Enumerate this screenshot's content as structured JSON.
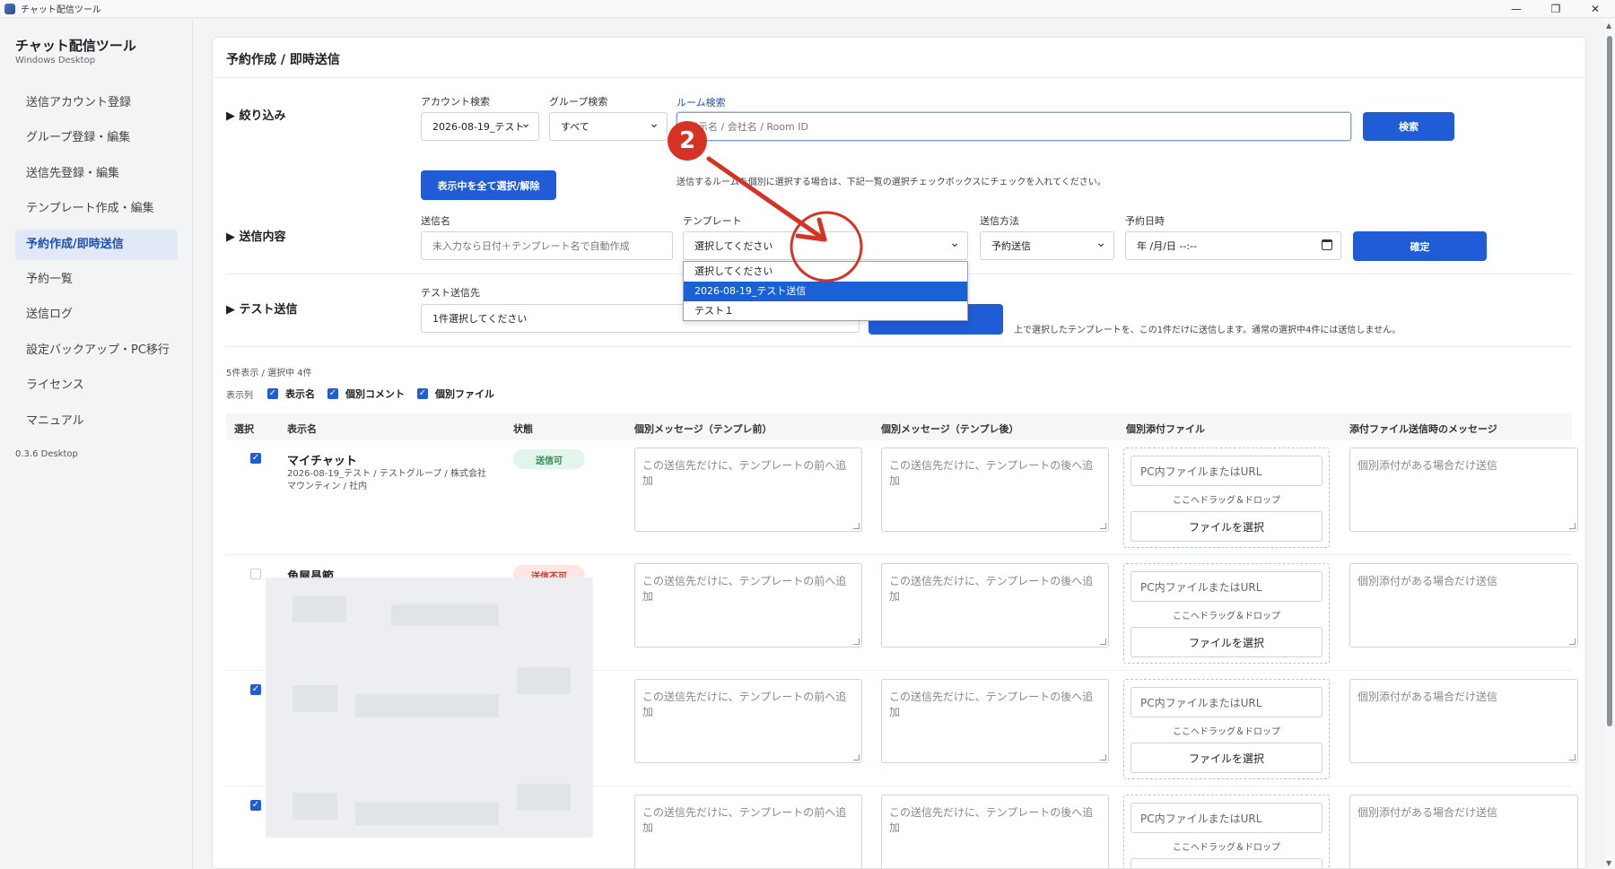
{
  "window": {
    "title": "チャット配信ツール",
    "controls": [
      "—",
      "❐",
      "✕"
    ]
  },
  "sidebar": {
    "brand": "チャット配信ツール",
    "brand_sub": "Windows Desktop",
    "items": [
      {
        "label": "送信アカウント登録"
      },
      {
        "label": "グループ登録・編集"
      },
      {
        "label": "送信先登録・編集"
      },
      {
        "label": "テンプレート作成・編集"
      },
      {
        "label": "予約作成/即時送信",
        "active": true
      },
      {
        "label": "予約一覧"
      },
      {
        "label": "送信ログ"
      },
      {
        "label": "設定バックアップ・PC移行"
      },
      {
        "label": "ライセンス"
      },
      {
        "label": "マニュアル"
      }
    ],
    "version": "0.3.6 Desktop"
  },
  "panel": {
    "title": "予約作成 / 即時送信"
  },
  "filter": {
    "label": "▶ 絞り込み",
    "account_label": "アカウント検索",
    "account_value": "2026-08-19_テスト",
    "group_label": "グループ検索",
    "group_value": "すべて",
    "room_label": "ルーム検索",
    "room_placeholder": "表示名 / 会社名 / Room ID",
    "search_button": "検索",
    "select_all_button": "表示中を全て選択/解除",
    "hint": "送信するルームを個別に選択する場合は、下記一覧の選択チェックボックスにチェックを入れてください。"
  },
  "content": {
    "label": "▶ 送信内容",
    "send_name_label": "送信名",
    "send_name_placeholder": "未入力なら日付＋テンプレート名で自動作成",
    "template_label": "テンプレート",
    "template_value": "選択してください",
    "template_options": [
      "選択してください",
      "2026-08-19_テスト送信",
      "テスト１"
    ],
    "method_label": "送信方法",
    "method_value": "予約送信",
    "datetime_label": "予約日時",
    "datetime_value": "年 /月/日 --:--",
    "confirm_button": "確定"
  },
  "test": {
    "label": "▶ テスト送信",
    "target_label": "テスト送信先",
    "target_value": "1件選択してください",
    "hint": "上で選択したテンプレートを、この1件だけに送信します。通常の選択中4件には送信しません。"
  },
  "callout": {
    "number": "2",
    "color": "#d63324"
  },
  "table": {
    "count": "5件表示 / 選択中 4件",
    "cols_label": "表示列",
    "col_options": [
      "表示名",
      "個別コメント",
      "個別ファイル"
    ],
    "headers": [
      "選択",
      "表示名",
      "状態",
      "個別メッセージ（テンプレ前）",
      "個別メッセージ（テンプレ後）",
      "個別添付ファイル",
      "添付ファイル送信時のメッセージ"
    ],
    "rows": [
      {
        "checked": true,
        "name": "マイチャット",
        "sub": "2026-08-19_テスト / テストグループ / 株式会社マウンティン / 社内",
        "status": "送信可",
        "status_kind": "ok"
      },
      {
        "checked": false,
        "name": "角屋昌範",
        "sub": "",
        "status": "送信不可",
        "status_kind": "ng"
      },
      {
        "checked": true,
        "name": "",
        "sub": "",
        "status": "",
        "status_kind": ""
      },
      {
        "checked": true,
        "name": "",
        "sub": "",
        "status": "",
        "status_kind": ""
      }
    ],
    "pre_placeholder": "この送信先だけに、テンプレートの前へ追加",
    "post_placeholder": "この送信先だけに、テンプレートの後へ追加",
    "file_placeholder": "PC内ファイルまたはURL",
    "drop_text": "ここへドラッグ＆ドロップ",
    "file_button": "ファイルを選択",
    "attach_placeholder": "個別添付がある場合だけ送信"
  },
  "colors": {
    "accent": "#1f5cd6",
    "active_nav_bg": "#e1e8f6"
  }
}
